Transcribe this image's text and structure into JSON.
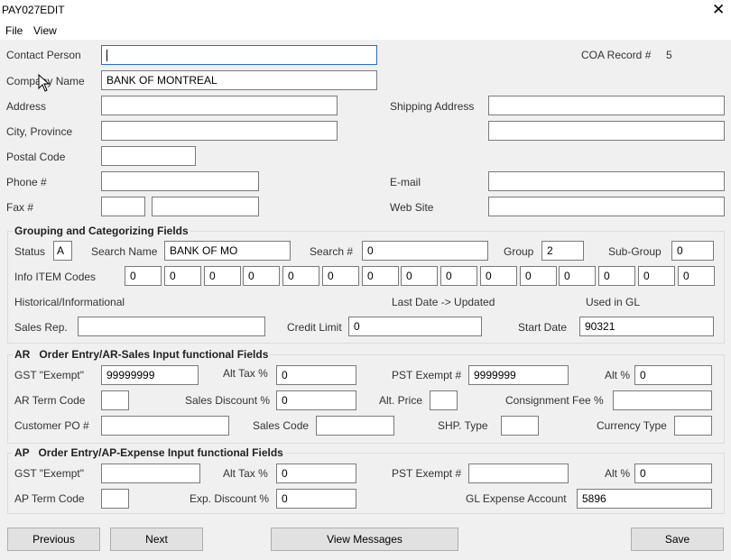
{
  "window": {
    "title": "PAY027EDIT",
    "close_glyph": "✕"
  },
  "menu": {
    "file": "File",
    "view": "View"
  },
  "contact": {
    "contact_person_label": "Contact Person",
    "contact_person_value": "",
    "coa_label": "COA Record #",
    "coa_value": "5",
    "company_name_label": "Company Name",
    "company_name_value": "BANK OF MONTREAL",
    "address_label": "Address",
    "address_value": "",
    "shipping_label": "Shipping Address",
    "shipping_value_1": "",
    "shipping_value_2": "",
    "city_label": "City, Province",
    "city_value": "",
    "postal_label": "Postal Code",
    "postal_value": "",
    "phone_label": "Phone #",
    "phone_value": "",
    "email_label": "E-mail",
    "email_value": "",
    "fax_label": "Fax #",
    "fax_value_1": "",
    "fax_value_2": "",
    "web_label": "Web Site",
    "web_value": ""
  },
  "grouping": {
    "title": "Grouping and Categorizing Fields",
    "status_label": "Status",
    "status_value": "A",
    "search_name_label": "Search Name",
    "search_name_value": "BANK OF MO",
    "search_num_label": "Search #",
    "search_num_value": "0",
    "group_label": "Group",
    "group_value": "2",
    "subgroup_label": "Sub-Group",
    "subgroup_value": "0",
    "info_label": "Info ITEM Codes",
    "info_codes": [
      "0",
      "0",
      "0",
      "0",
      "0",
      "0",
      "0",
      "0",
      "0",
      "0",
      "0",
      "0",
      "0",
      "0",
      "0"
    ],
    "historical_label": "Historical/Informational",
    "last_date_label": "Last Date -> Updated",
    "used_gl_label": "Used in GL",
    "sales_rep_label": "Sales Rep.",
    "sales_rep_value": "",
    "credit_limit_label": "Credit Limit",
    "credit_limit_value": "0",
    "start_date_label": "Start Date",
    "start_date_value": "90321"
  },
  "ar": {
    "title": "AR   Order Entry/AR-Sales Input functional Fields",
    "gst_label": "GST \"Exempt\"",
    "gst_value": "99999999",
    "alt_tax_label": "Alt Tax %",
    "alt_tax_value": "0",
    "pst_label": "PST Exempt #",
    "pst_value": "9999999",
    "alt_pct_label": "Alt %",
    "alt_pct_value": "0",
    "term_label": "AR Term Code",
    "term_value": "",
    "sales_disc_label": "Sales Discount %",
    "sales_disc_value": "0",
    "alt_price_label": "Alt. Price",
    "alt_price_value": "",
    "consign_label": "Consignment Fee %",
    "consign_value": "",
    "po_label": "Customer PO #",
    "po_value": "",
    "sales_code_label": "Sales Code",
    "sales_code_value": "",
    "shp_label": "SHP. Type",
    "shp_value": "",
    "currency_label": "Currency Type",
    "currency_value": ""
  },
  "ap": {
    "title": "AP   Order Entry/AP-Expense Input functional Fields",
    "gst_label": "GST \"Exempt\"",
    "gst_value": "",
    "alt_tax_label": "Alt Tax %",
    "alt_tax_value": "0",
    "pst_label": "PST Exempt #",
    "pst_value": "",
    "alt_pct_label": "Alt %",
    "alt_pct_value": "0",
    "term_label": "AP Term Code",
    "term_value": "",
    "exp_disc_label": "Exp. Discount %",
    "exp_disc_value": "0",
    "gl_label": "GL Expense Account",
    "gl_value": "5896"
  },
  "buttons": {
    "previous": "Previous",
    "next": "Next",
    "view_messages": "View Messages",
    "save": "Save"
  }
}
